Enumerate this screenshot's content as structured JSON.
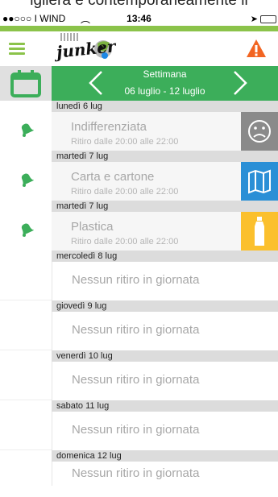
{
  "caption": "igliera e contemporaneamente il",
  "status_bar": {
    "carrier": "●●○○○ I WIND",
    "time": "13:46"
  },
  "header": {
    "logo_text": "junker",
    "accent_color": "#8bc34a",
    "warning_color": "#f26522"
  },
  "week": {
    "title": "Settimana",
    "range": "06 luglio - 12 luglio",
    "color": "#3cae5a"
  },
  "days": [
    {
      "label": "lunedì 6 lug",
      "type": "Indifferenziata",
      "time": "Ritiro dalle 20:00 alle 22:00",
      "badge": "sad-face-icon",
      "badge_color": "#8a8a8a",
      "bell": true
    },
    {
      "label": "martedì 7 lug",
      "type": "Carta e cartone",
      "time": "Ritiro dalle 20:00 alle 22:00",
      "badge": "map-icon",
      "badge_color": "#2a8fd6",
      "bell": true
    },
    {
      "label": "martedì 7 lug",
      "type": "Plastica",
      "time": "Ritiro dalle 20:00 alle 22:00",
      "badge": "bottle-icon",
      "badge_color": "#fbc02d",
      "bell": true
    },
    {
      "label": "mercoledì 8 lug",
      "type": "Nessun ritiro in giornata"
    },
    {
      "label": "giovedì 9 lug",
      "type": "Nessun ritiro in giornata"
    },
    {
      "label": "venerdì 10 lug",
      "type": "Nessun ritiro in giornata"
    },
    {
      "label": "sabato 11 lug",
      "type": "Nessun ritiro in giornata"
    },
    {
      "label": "domenica 12 lug",
      "type": "Nessun ritiro in giornata"
    }
  ]
}
